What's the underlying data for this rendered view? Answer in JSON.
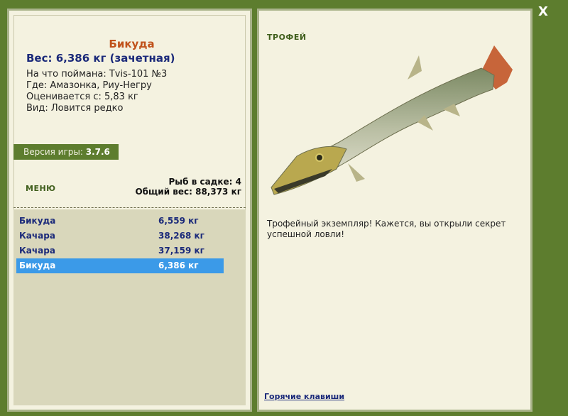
{
  "fish": {
    "name": "Бикуда",
    "weight_line": "Вес: 6,386 кг (зачетная)",
    "caught_with": "На что поймана: Tvis-101 №3",
    "location": "Где: Амазонка, Риу-Негру",
    "rated_from": "Оценивается с: 5,83 кг",
    "rarity": "Вид: Ловится редко"
  },
  "version": {
    "label": "Версия игры:",
    "value": "3.7.6"
  },
  "menu_label": "МЕНЮ",
  "stats": {
    "count_line": "Рыб в садке: 4",
    "total_line": "Общий вес: 88,373 кг"
  },
  "catch_list": [
    {
      "name": "Бикуда",
      "weight": "6,559 кг"
    },
    {
      "name": "Качара",
      "weight": "38,268 кг"
    },
    {
      "name": "Качара",
      "weight": "37,159 кг"
    },
    {
      "name": "Бикуда",
      "weight": "6,386 кг"
    }
  ],
  "selected_index": 3,
  "trophy": {
    "heading": "ТРОФЕЙ",
    "text": "Трофейный экземпляр! Кажется, вы открыли секрет успешной ловли!"
  },
  "hotkeys_label": "Горячие клавиши",
  "close_label": "X",
  "colors": {
    "frame": "#5d7d2e",
    "panel": "#f4f2e0",
    "list_bg": "#d9d7bb",
    "selected": "#3b9ae8",
    "fish_name": "#c0521b",
    "text_blue": "#1b2a7a"
  }
}
